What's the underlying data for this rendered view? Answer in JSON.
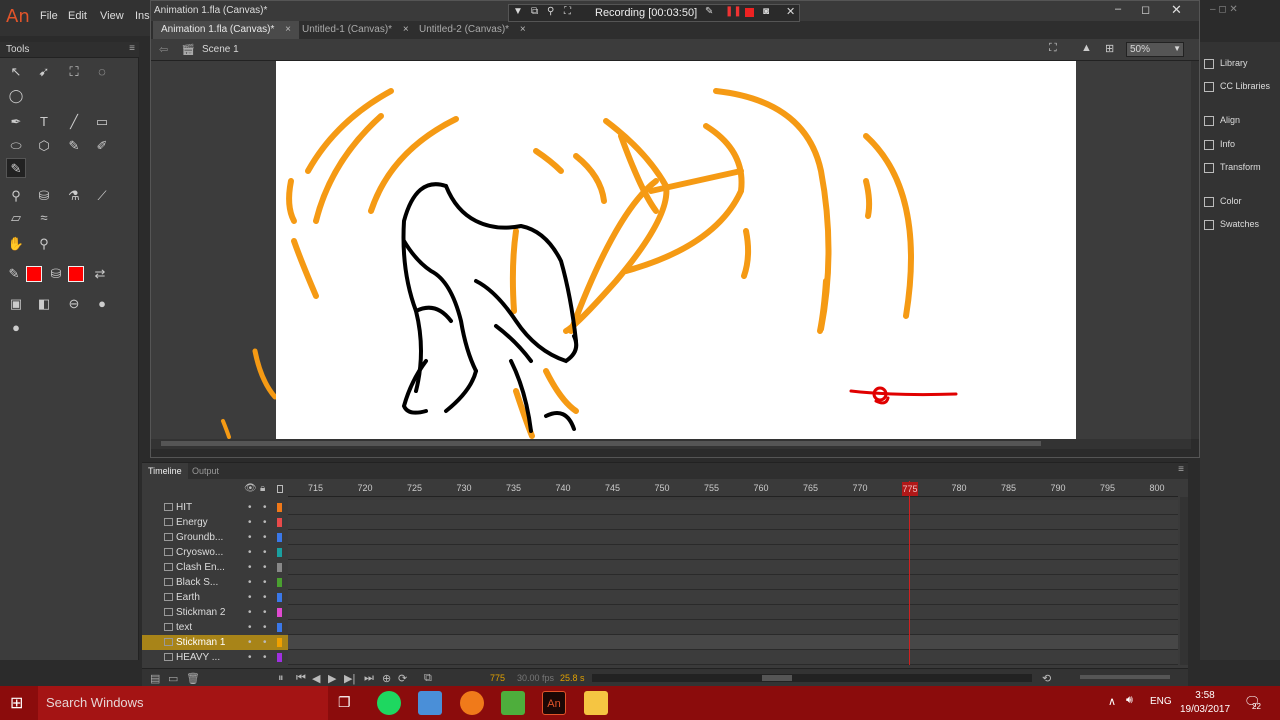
{
  "app": {
    "logo": "An",
    "menus": [
      "File",
      "Edit",
      "View",
      "Ins"
    ]
  },
  "document": {
    "title": "Animation 1.fla (Canvas)*",
    "tabs": [
      {
        "label": "Animation 1.fla (Canvas)*",
        "active": true
      },
      {
        "label": "Untitled-1 (Canvas)*",
        "active": false
      },
      {
        "label": "Untitled-2 (Canvas)*",
        "active": false
      }
    ],
    "scene": "Scene 1",
    "zoom": "50%"
  },
  "recording": {
    "label": "Recording [00:03:50]"
  },
  "tools": {
    "title": "Tools"
  },
  "right_panel": [
    "Library",
    "CC Libraries",
    "Align",
    "Info",
    "Transform",
    "Color",
    "Swatches"
  ],
  "timeline": {
    "tabs": [
      "Timeline",
      "Output"
    ],
    "ruler": [
      "715",
      "720",
      "725",
      "730",
      "735",
      "740",
      "745",
      "750",
      "755",
      "760",
      "765",
      "770",
      "775",
      "780",
      "785",
      "790",
      "795",
      "800"
    ],
    "current_frame": "775",
    "fps": "30.00 fps",
    "time": "25.8 s",
    "layers": [
      {
        "name": "HIT",
        "color": "#f07818"
      },
      {
        "name": "Energy",
        "color": "#e84a4a"
      },
      {
        "name": "Groundb...",
        "color": "#3a78e8"
      },
      {
        "name": "Cryoswo...",
        "color": "#1aa0a0"
      },
      {
        "name": "Clash En...",
        "color": "#888888"
      },
      {
        "name": "Black S...",
        "color": "#4aa030"
      },
      {
        "name": "Earth",
        "color": "#3a78e8"
      },
      {
        "name": "Stickman 2",
        "color": "#e04ad0"
      },
      {
        "name": "text",
        "color": "#3a78e8"
      },
      {
        "name": "Stickman 1",
        "color": "#f0a000",
        "selected": true
      },
      {
        "name": "HEAVY ...",
        "color": "#a030e0"
      }
    ]
  },
  "taskbar": {
    "search_placeholder": "Search Windows",
    "language": "ENG",
    "time": "3:58",
    "date": "19/03/2017",
    "notifications": "22"
  },
  "colors": {
    "accent_orange": "#f59a14",
    "stroke_color": "#ff0000",
    "taskbar": "#8b0c0c",
    "stage": "#ffffff"
  }
}
